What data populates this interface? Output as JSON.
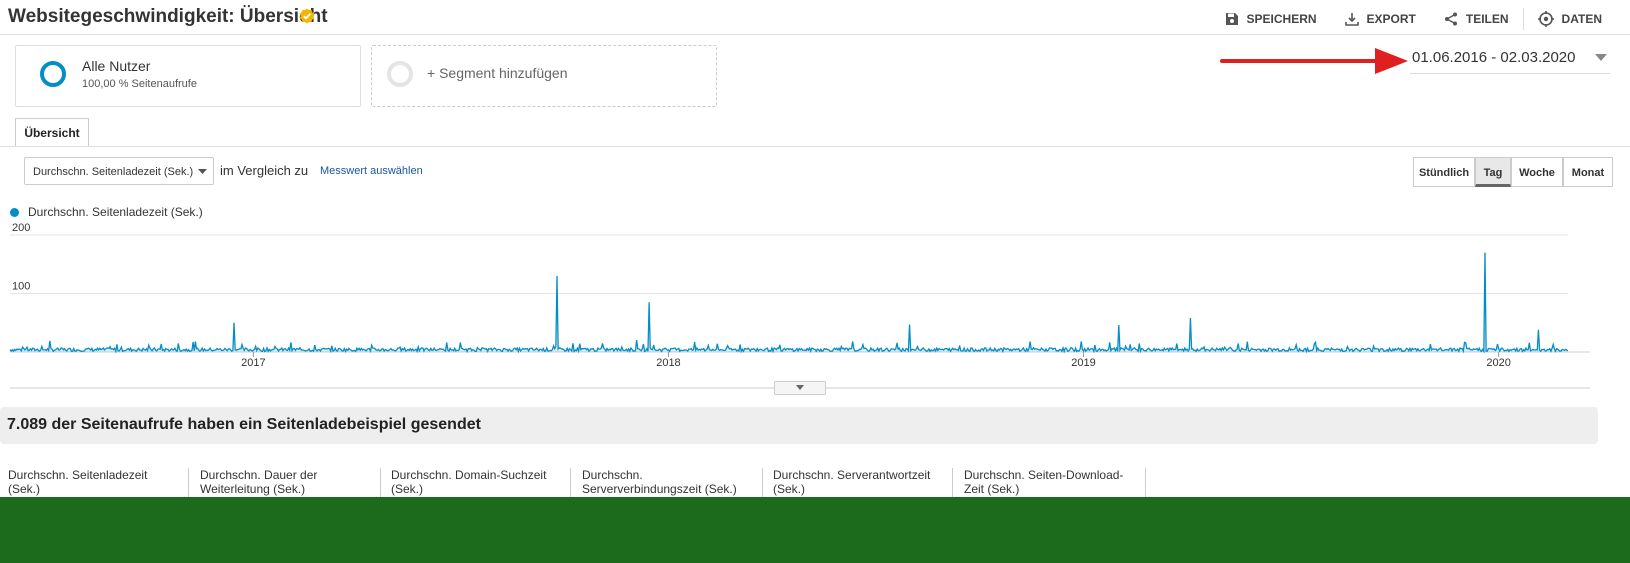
{
  "header": {
    "title": "Websitegeschwindigkeit: Übersicht",
    "actions": [
      {
        "label": "SPEICHERN",
        "icon": "save-icon"
      },
      {
        "label": "EXPORT",
        "icon": "download-icon"
      },
      {
        "label": "TEILEN",
        "icon": "share-icon"
      },
      {
        "label": "DATEN",
        "icon": "data-icon"
      }
    ]
  },
  "segments": {
    "active_name": "Alle Nutzer",
    "active_sub": "100,00 % Seitenaufrufe",
    "add_label": "+ Segment hinzufügen"
  },
  "date_range": "01.06.2016 - 02.03.2020",
  "tabs": [
    {
      "label": "Übersicht"
    }
  ],
  "controls": {
    "metric_select": "Durchschn. Seitenladezeit (Sek.)",
    "compare_text": "im Vergleich zu",
    "compare_link": "Messwert auswählen",
    "granularity": [
      "Stündlich",
      "Tag",
      "Woche",
      "Monat"
    ],
    "granularity_active": "Tag"
  },
  "colors": {
    "series": "#058dc7",
    "accent_arrow": "#e02020",
    "link": "#1a55a8",
    "verified": "#f2b705"
  },
  "chart_data": {
    "type": "line",
    "legend": "Durchschn. Seitenladezeit (Sek.)",
    "yticks": [
      "200",
      "100"
    ],
    "ylim": [
      0,
      200
    ],
    "x_labels": [
      "2017",
      "2018",
      "2019",
      "2020"
    ],
    "x_range": [
      "2016-06-01",
      "2020-03-02"
    ],
    "baseline": 4,
    "spikes": [
      {
        "x": "2016-12-15",
        "y": 50
      },
      {
        "x": "2017-09-25",
        "y": 130
      },
      {
        "x": "2017-12-15",
        "y": 85
      },
      {
        "x": "2018-08-01",
        "y": 47
      },
      {
        "x": "2019-02-01",
        "y": 46
      },
      {
        "x": "2019-04-05",
        "y": 58
      },
      {
        "x": "2019-12-20",
        "y": 170
      },
      {
        "x": "2020-02-05",
        "y": 38
      }
    ]
  },
  "summary": {
    "headline": "7.089 der Seitenaufrufe haben ein Seitenladebeispiel gesendet"
  },
  "metric_columns": [
    {
      "l1": "Durchschn. Seitenladezeit",
      "l2": "(Sek.)"
    },
    {
      "l1": "Durchschn. Dauer der",
      "l2": "Weiterleitung (Sek.)"
    },
    {
      "l1": "Durchschn. Domain-Suchzeit",
      "l2": "(Sek.)"
    },
    {
      "l1": "Durchschn.",
      "l2": "Serververbindungszeit (Sek.)"
    },
    {
      "l1": "Durchschn. Serverantwortzeit",
      "l2": "(Sek.)"
    },
    {
      "l1": "Durchschn. Seiten-Download-",
      "l2": "Zeit (Sek.)"
    }
  ]
}
